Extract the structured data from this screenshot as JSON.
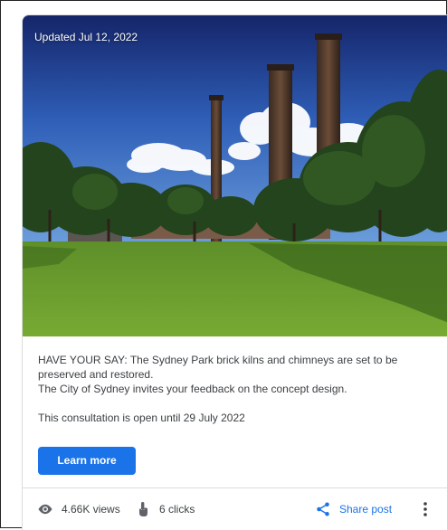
{
  "post": {
    "updated_label": "Updated Jul 12, 2022",
    "text_line1": "HAVE YOUR SAY: The Sydney Park brick kilns and chimneys are set to be preserved and restored.",
    "text_line2": "The City of Sydney invites your feedback on the concept design.",
    "text_line3": "This consultation is open until 29 July 2022",
    "learn_more_label": "Learn more"
  },
  "stats": {
    "views_label": "4.66K views",
    "clicks_label": "6 clicks",
    "share_label": "Share post"
  },
  "icons": {
    "views": "eye-icon",
    "clicks": "touch-icon",
    "share": "share-icon",
    "more": "more-vert-icon"
  },
  "colors": {
    "accent": "#1a73e8",
    "text": "#3c4043",
    "divider": "#dadce0"
  }
}
